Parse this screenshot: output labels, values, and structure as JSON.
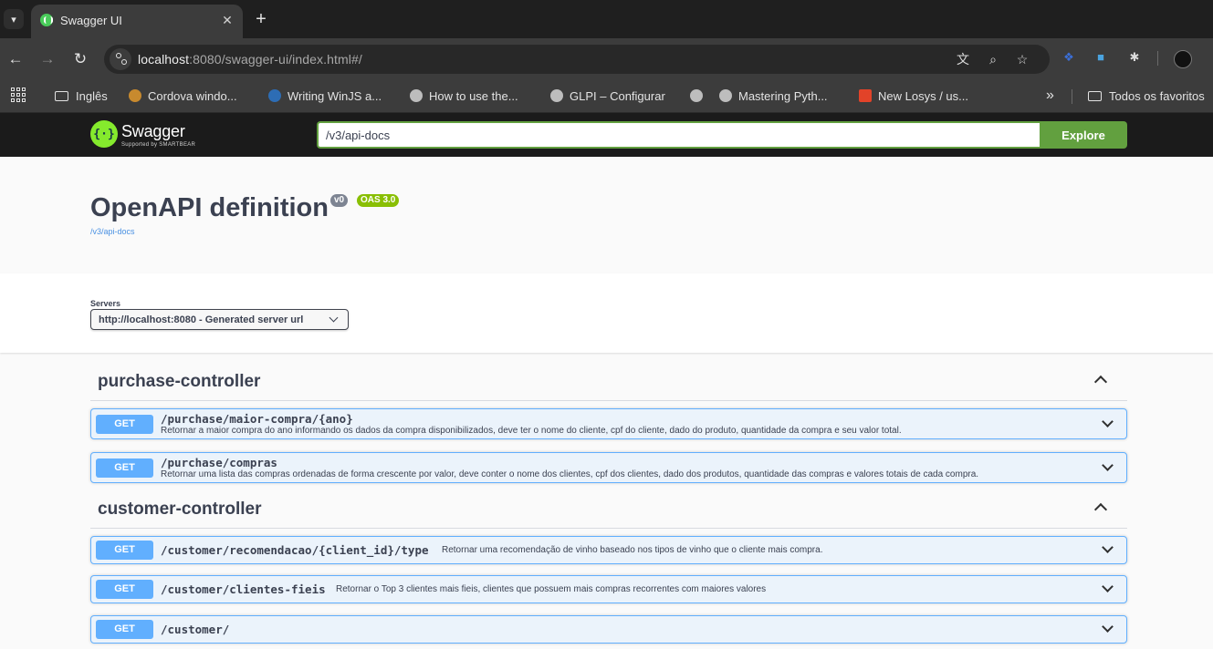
{
  "browser": {
    "tab_title": "Swagger UI",
    "url_host": "localhost",
    "url_rest": ":8080/swagger-ui/index.html#/",
    "bookmarks": [
      "Inglês",
      "Cordova windo...",
      "Writing WinJS a...",
      "How to use the...",
      "GLPI – Configurar",
      "Mastering Pyth...",
      "New Losys / us..."
    ],
    "bookmarks_folder": "Todos os favoritos"
  },
  "swagger": {
    "brand": "Swagger",
    "brand_sub": "Supported by SMARTBEAR",
    "spec_url": "/v3/api-docs",
    "explore_label": "Explore"
  },
  "info": {
    "title": "OpenAPI definition",
    "version": "v0",
    "oas": "OAS 3.0",
    "link": "/v3/api-docs"
  },
  "servers": {
    "label": "Servers",
    "selected": "http://localhost:8080 - Generated server url"
  },
  "tags": [
    {
      "name": "purchase-controller",
      "operations": [
        {
          "method": "GET",
          "path": "/purchase/maior-compra/{ano}",
          "summary": "Retornar a maior compra do ano informando os dados da compra disponibilizados, deve ter o nome do cliente, cpf do cliente, dado do produto, quantidade da compra e seu valor total."
        },
        {
          "method": "GET",
          "path": "/purchase/compras",
          "summary": "Retornar uma lista das compras ordenadas de forma crescente por valor, deve conter o nome dos clientes, cpf dos clientes, dado dos produtos, quantidade das compras e valores totais de cada compra."
        }
      ]
    },
    {
      "name": "customer-controller",
      "operations": [
        {
          "method": "GET",
          "path": "/customer/recomendacao/{client_id}/type",
          "summary": "Retornar uma recomendação de vinho baseado nos tipos de vinho que o cliente mais compra."
        },
        {
          "method": "GET",
          "path": "/customer/clientes-fieis",
          "summary": "Retornar o Top 3 clientes mais fieis, clientes que possuem mais compras recorrentes com maiores valores"
        },
        {
          "method": "GET",
          "path": "/customer/",
          "summary": ""
        }
      ]
    }
  ]
}
